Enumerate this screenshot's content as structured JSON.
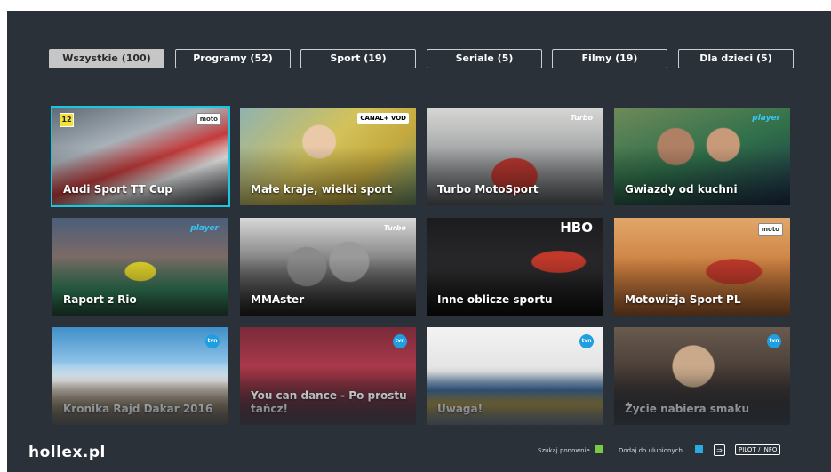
{
  "tabs": [
    {
      "label": "Wszystkie (100)",
      "active": true
    },
    {
      "label": "Programy (52)",
      "active": false
    },
    {
      "label": "Sport (19)",
      "active": false
    },
    {
      "label": "Seriale (5)",
      "active": false
    },
    {
      "label": "Filmy (19)",
      "active": false
    },
    {
      "label": "Dla dzieci (5)",
      "active": false
    }
  ],
  "tiles": [
    {
      "title": "Audi Sport TT Cup",
      "logo": "moto",
      "focused": true,
      "age": "12"
    },
    {
      "title": "Małe kraje, wielki sport",
      "logo": "CANAL+ VOD"
    },
    {
      "title": "Turbo MotoSport",
      "logo": "Turbo"
    },
    {
      "title": "Gwiazdy od kuchni",
      "logo": "player"
    },
    {
      "title": "Raport z Rio",
      "logo": "player"
    },
    {
      "title": "MMAster",
      "logo": "Turbo"
    },
    {
      "title": "Inne oblicze sportu",
      "logo": "HBO"
    },
    {
      "title": "Motowizja Sport PL",
      "logo": "moto"
    },
    {
      "title": "Kronika Rajd Dakar 2016",
      "logo": "tvn"
    },
    {
      "title": "You can dance - Po prostu tańcz!",
      "logo": "tvn"
    },
    {
      "title": "Uwaga!",
      "logo": "tvn"
    },
    {
      "title": "Życie nabiera smaku",
      "logo": "tvn"
    }
  ],
  "footer": {
    "brand": "hollex.pl",
    "hint_search": "Szukaj ponownie",
    "hint_favorite": "Dodaj do ulubionych",
    "hint_pilot": "PILOT / INFO"
  },
  "colors": {
    "background": "#2a3139",
    "focus": "#19c7e0",
    "search_key": "#7ac943",
    "favorite_key": "#29abe2"
  }
}
